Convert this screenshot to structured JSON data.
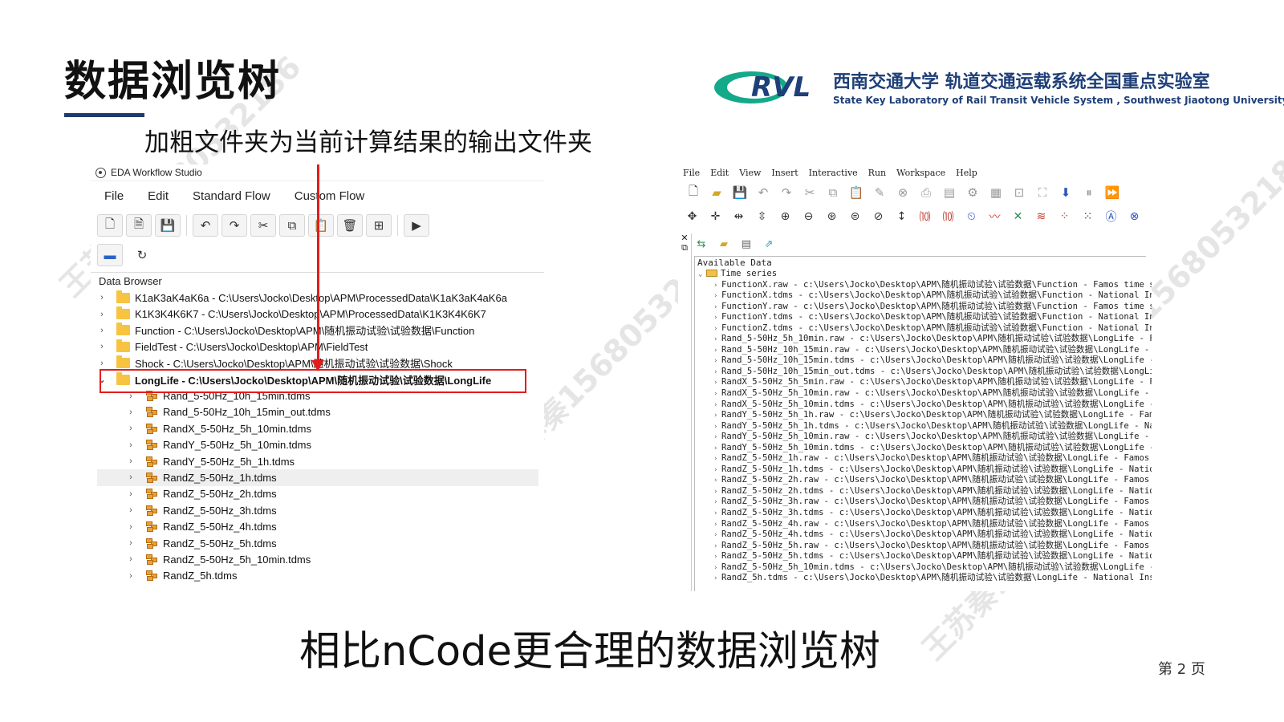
{
  "slide": {
    "title": "数据浏览树",
    "subtitle": "加粗文件夹为当前计算结果的输出文件夹",
    "bottom_title": "相比nCode更合理的数据浏览树",
    "page_number": "第 2 页",
    "accent_color": "#1f3b6e",
    "highlight_color": "#e41c1c"
  },
  "logo": {
    "mark_text": "RVL",
    "cn_text": "西南交通大学 轨道交通运载系统全国重点实验室",
    "en_text": "State Key Laboratory of Rail Transit Vehicle System , Southwest Jiaotong University"
  },
  "watermark": {
    "text_a": "王苏秦15680532186",
    "text_b": "王苏秦1568053"
  },
  "left_app": {
    "window_title": "EDA Workflow Studio",
    "menu": [
      "File",
      "Edit",
      "Standard Flow",
      "Custom Flow"
    ],
    "panel_title": "Data Browser",
    "folders": [
      {
        "label": "K1aK3aK4aK6a - C:\\Users\\Jocko\\Desktop\\APM\\ProcessedData\\K1aK3aK4aK6a"
      },
      {
        "label": "K1K3K4K6K7 - C:\\Users\\Jocko\\Desktop\\APM\\ProcessedData\\K1K3K4K6K7"
      },
      {
        "label": "Function - C:\\Users\\Jocko\\Desktop\\APM\\随机振动试验\\试验数据\\Function"
      },
      {
        "label": "FieldTest - C:\\Users\\Jocko\\Desktop\\APM\\FieldTest"
      },
      {
        "label": "Shock - C:\\Users\\Jocko\\Desktop\\APM\\随机振动试验\\试验数据\\Shock"
      },
      {
        "label": "LongLife - C:\\Users\\Jocko\\Desktop\\APM\\随机振动试验\\试验数据\\LongLife"
      }
    ],
    "files": [
      "Rand_5-50Hz_10h_15min.tdms",
      "Rand_5-50Hz_10h_15min_out.tdms",
      "RandX_5-50Hz_5h_10min.tdms",
      "RandY_5-50Hz_5h_10min.tdms",
      "RandY_5-50Hz_5h_1h.tdms",
      "RandZ_5-50Hz_1h.tdms",
      "RandZ_5-50Hz_2h.tdms",
      "RandZ_5-50Hz_3h.tdms",
      "RandZ_5-50Hz_4h.tdms",
      "RandZ_5-50Hz_5h.tdms",
      "RandZ_5-50Hz_5h_10min.tdms",
      "RandZ_5h.tdms"
    ]
  },
  "right_app": {
    "menu": [
      "File",
      "Edit",
      "View",
      "Insert",
      "Interactive",
      "Run",
      "Workspace",
      "Help"
    ],
    "side_labels": [
      "✕",
      "⧉"
    ],
    "panel_title": "Available Data",
    "root_label": "Time series",
    "items": [
      "FunctionX.raw - c:\\Users\\Jocko\\Desktop\\APM\\随机振动试验\\试验数据\\Function - Famos time serie",
      "FunctionX.tdms - c:\\Users\\Jocko\\Desktop\\APM\\随机振动试验\\试验数据\\Function - National Instru",
      "FunctionY.raw - c:\\Users\\Jocko\\Desktop\\APM\\随机振动试验\\试验数据\\Function - Famos time serie",
      "FunctionY.tdms - c:\\Users\\Jocko\\Desktop\\APM\\随机振动试验\\试验数据\\Function - National Instru",
      "FunctionZ.tdms - c:\\Users\\Jocko\\Desktop\\APM\\随机振动试验\\试验数据\\Function - National Instru",
      "Rand_5-50Hz_5h_10min.raw - c:\\Users\\Jocko\\Desktop\\APM\\随机振动试验\\试验数据\\LongLife - Famos",
      "Rand_5-50Hz_10h_15min.raw - c:\\Users\\Jocko\\Desktop\\APM\\随机振动试验\\试验数据\\LongLife - Famo",
      "Rand_5-50Hz_10h_15min.tdms - c:\\Users\\Jocko\\Desktop\\APM\\随机振动试验\\试验数据\\LongLife - Nat",
      "Rand_5-50Hz_10h_15min_out.tdms - c:\\Users\\Jocko\\Desktop\\APM\\随机振动试验\\试验数据\\LongLife -",
      "RandX_5-50Hz_5h_5min.raw - c:\\Users\\Jocko\\Desktop\\APM\\随机振动试验\\试验数据\\LongLife - Famos",
      "RandX_5-50Hz_5h_10min.raw - c:\\Users\\Jocko\\Desktop\\APM\\随机振动试验\\试验数据\\LongLife - Famo",
      "RandX_5-50Hz_5h_10min.tdms - c:\\Users\\Jocko\\Desktop\\APM\\随机振动试验\\试验数据\\LongLife - Nat",
      "RandY_5-50Hz_5h_1h.raw - c:\\Users\\Jocko\\Desktop\\APM\\随机振动试验\\试验数据\\LongLife - Famos t",
      "RandY_5-50Hz_5h_1h.tdms - c:\\Users\\Jocko\\Desktop\\APM\\随机振动试验\\试验数据\\LongLife - Natior",
      "RandY_5-50Hz_5h_10min.raw - c:\\Users\\Jocko\\Desktop\\APM\\随机振动试验\\试验数据\\LongLife - Famo",
      "RandY_5-50Hz_5h_10min.tdms - c:\\Users\\Jocko\\Desktop\\APM\\随机振动试验\\试验数据\\LongLife - Nat",
      "RandZ_5-50Hz_1h.raw - c:\\Users\\Jocko\\Desktop\\APM\\随机振动试验\\试验数据\\LongLife - Famos time",
      "RandZ_5-50Hz_1h.tdms - c:\\Users\\Jocko\\Desktop\\APM\\随机振动试验\\试验数据\\LongLife - National",
      "RandZ_5-50Hz_2h.raw - c:\\Users\\Jocko\\Desktop\\APM\\随机振动试验\\试验数据\\LongLife - Famos time",
      "RandZ_5-50Hz_2h.tdms - c:\\Users\\Jocko\\Desktop\\APM\\随机振动试验\\试验数据\\LongLife - National",
      "RandZ_5-50Hz_3h.raw - c:\\Users\\Jocko\\Desktop\\APM\\随机振动试验\\试验数据\\LongLife - Famos time",
      "RandZ_5-50Hz_3h.tdms - c:\\Users\\Jocko\\Desktop\\APM\\随机振动试验\\试验数据\\LongLife - National",
      "RandZ_5-50Hz_4h.raw - c:\\Users\\Jocko\\Desktop\\APM\\随机振动试验\\试验数据\\LongLife - Famos time",
      "RandZ_5-50Hz_4h.tdms - c:\\Users\\Jocko\\Desktop\\APM\\随机振动试验\\试验数据\\LongLife - National",
      "RandZ_5-50Hz_5h.raw - c:\\Users\\Jocko\\Desktop\\APM\\随机振动试验\\试验数据\\LongLife - Famos time",
      "RandZ_5-50Hz_5h.tdms - c:\\Users\\Jocko\\Desktop\\APM\\随机振动试验\\试验数据\\LongLife - National",
      "RandZ_5-50Hz_5h_10min.tdms - c:\\Users\\Jocko\\Desktop\\APM\\随机振动试验\\试验数据\\LongLife - Nat",
      "RandZ_5h.tdms - c:\\Users\\Jocko\\Desktop\\APM\\随机振动试验\\试验数据\\LongLife - National Instrum"
    ]
  }
}
